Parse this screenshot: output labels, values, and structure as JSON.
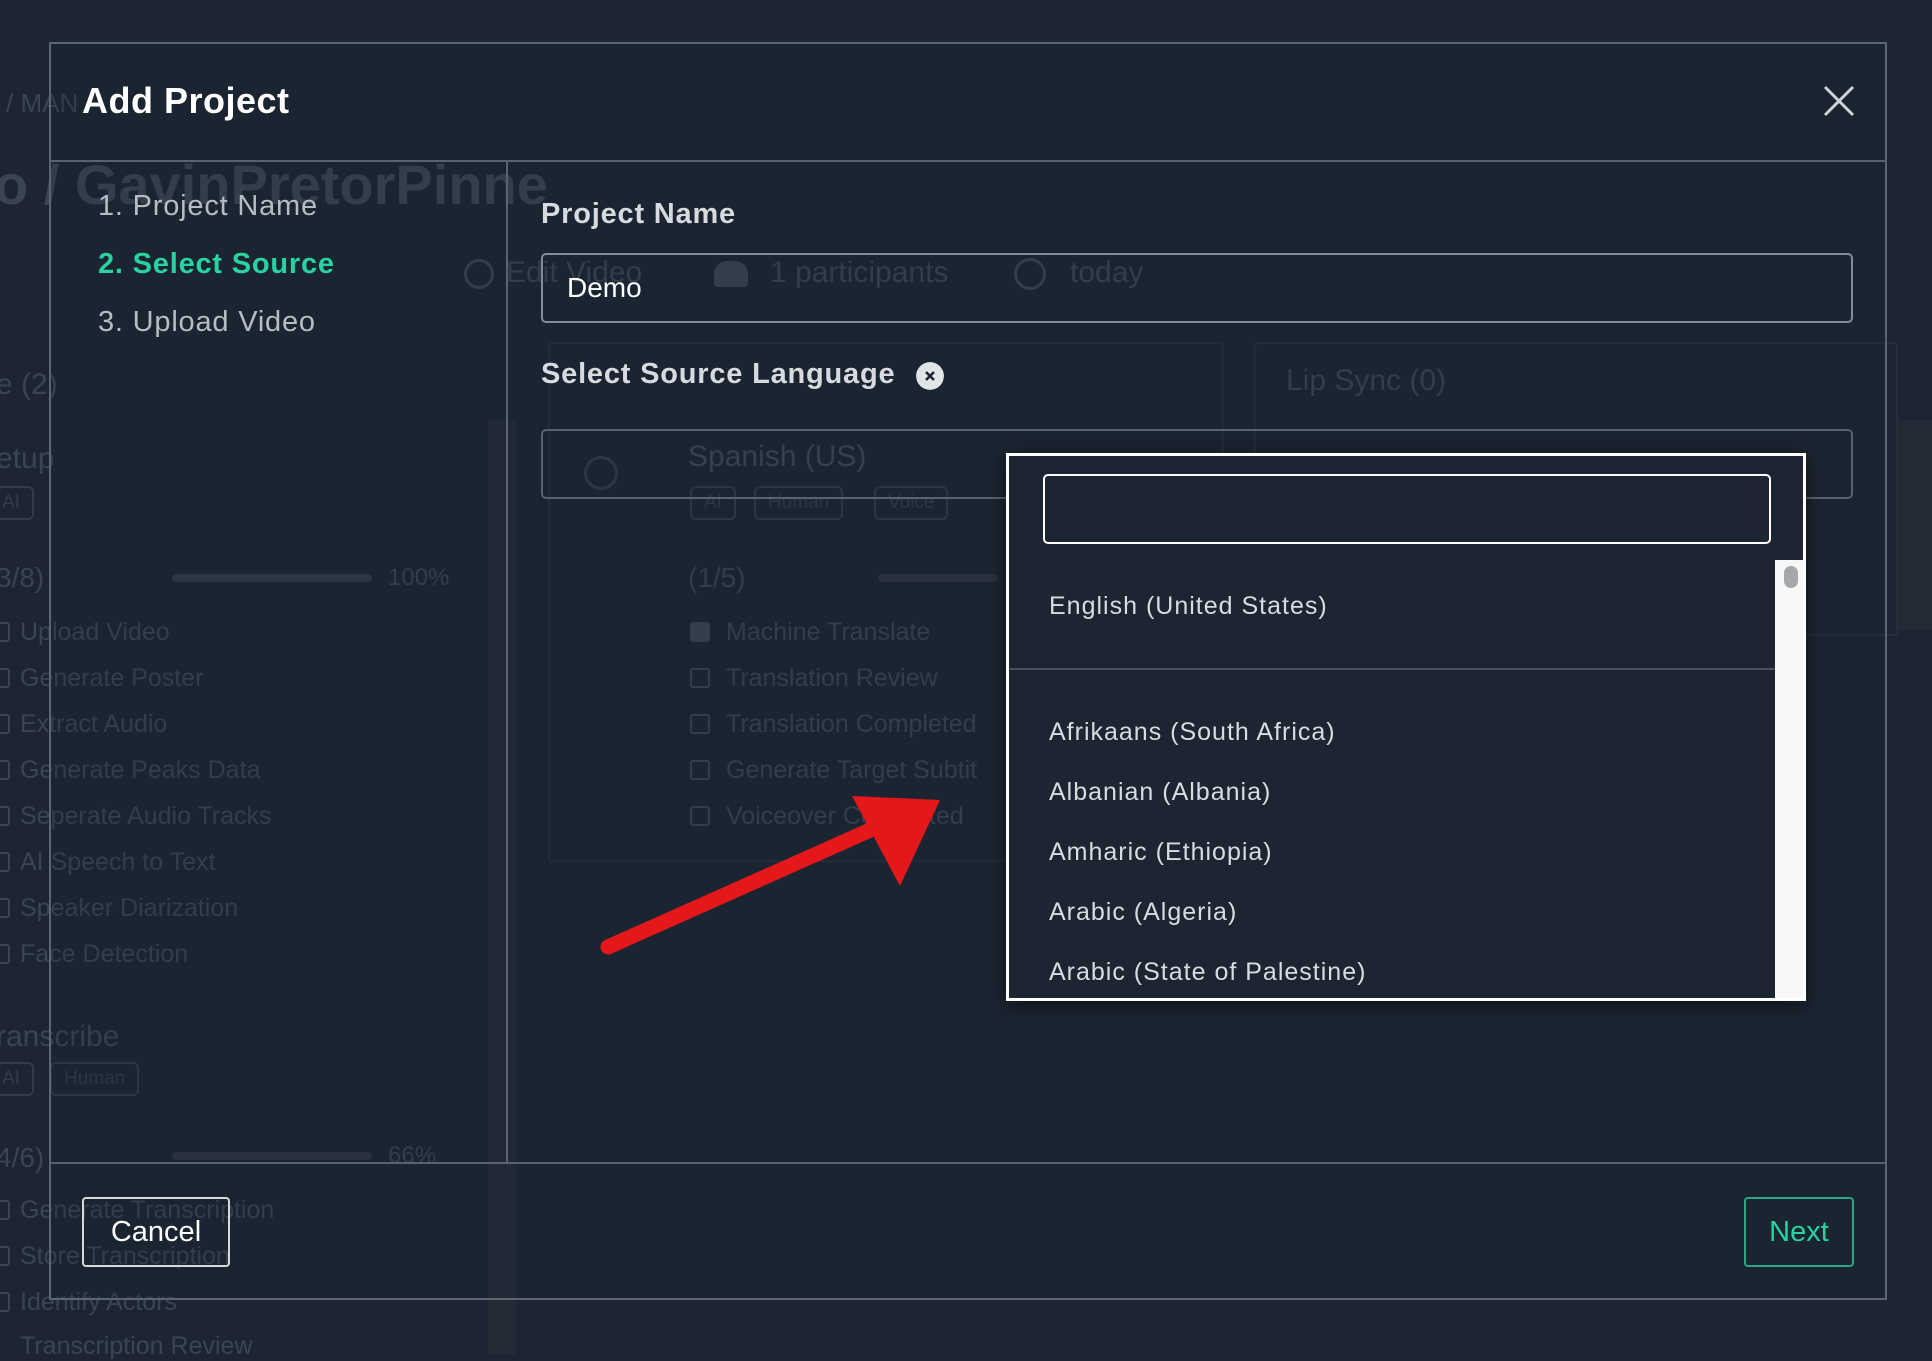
{
  "background": {
    "breadcrumb": "/ MAN",
    "page_title": "o / GavinPretorPinne",
    "meta": {
      "edit_video": "Edit Video",
      "participants": "1 participants",
      "date": "today"
    },
    "left_panel": {
      "header": "e (2)",
      "setup_title": "etup",
      "setup_chips": [
        "AI"
      ],
      "setup_progress_label": "3/8)",
      "setup_progress_value": "100%",
      "setup_tasks": [
        "Upload Video",
        "Generate Poster",
        "Extract Audio",
        "Generate Peaks Data",
        "Seperate Audio Tracks",
        "AI Speech to Text",
        "Speaker Diarization",
        "Face Detection"
      ],
      "transcribe_title": "ranscribe",
      "transcribe_chips": [
        "AI",
        "Human"
      ],
      "transcribe_progress_label": "4/6)",
      "transcribe_progress_value": "66%",
      "transcribe_tasks": [
        "Generate Transcription",
        "Store Transcription",
        "Identify Actors",
        "Transcription Review"
      ]
    },
    "language_card": {
      "title": "Spanish (US)",
      "chips": [
        "AI",
        "Human",
        "Voice"
      ],
      "progress_label": "(1/5)",
      "tasks": [
        "Machine Translate",
        "Translation Review",
        "Translation Completed",
        "Generate Target Subtit",
        "Voiceover Completed"
      ]
    },
    "lip_sync": "Lip Sync (0)"
  },
  "modal": {
    "title": "Add Project",
    "steps": [
      {
        "label": "1. Project Name",
        "active": false
      },
      {
        "label": "2. Select Source",
        "active": true
      },
      {
        "label": "3. Upload Video",
        "active": false
      }
    ],
    "project_name_label": "Project Name",
    "project_name_value": "Demo",
    "source_language_label": "Select Source Language",
    "dropdown": {
      "search_value": "",
      "pinned_option": "English (United States)",
      "options": [
        "Afrikaans (South Africa)",
        "Albanian (Albania)",
        "Amharic (Ethiopia)",
        "Arabic (Algeria)",
        "Arabic (State of Palestine)"
      ]
    },
    "cancel_label": "Cancel",
    "next_label": "Next"
  },
  "colors": {
    "background": "#1c2531",
    "accent": "#2ad1a2",
    "annotation_arrow": "#e4181b"
  }
}
